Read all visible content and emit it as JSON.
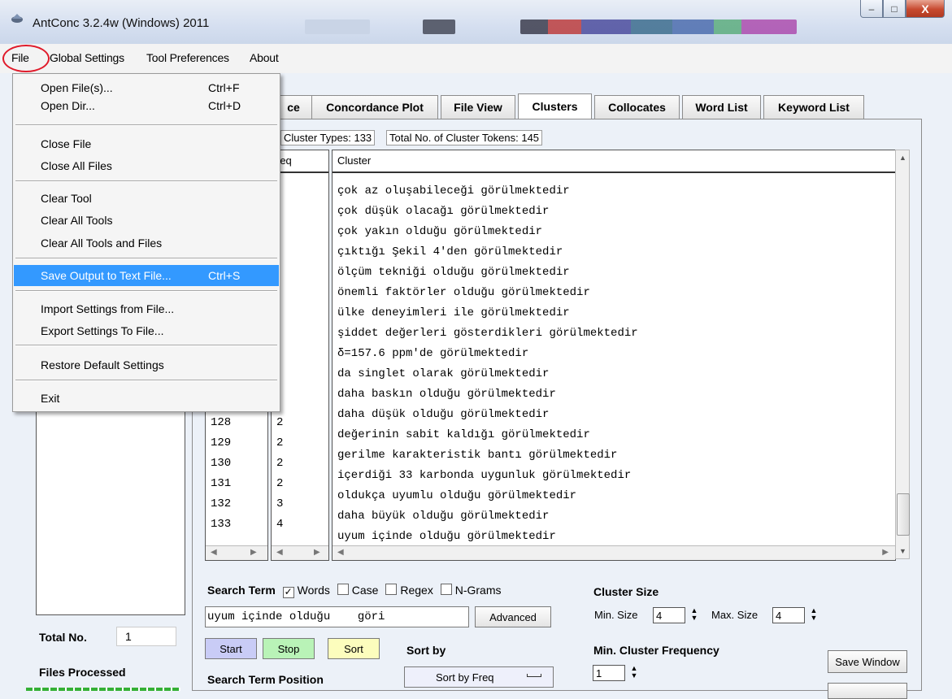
{
  "window": {
    "title": "AntConc 3.2.4w (Windows) 2011",
    "min": "–",
    "max": "□",
    "close": "X"
  },
  "menubar": {
    "file": "File",
    "global": "Global Settings",
    "tool": "Tool Preferences",
    "about": "About"
  },
  "file_menu": {
    "open_files": "Open File(s)...",
    "open_files_sc": "Ctrl+F",
    "open_dir": "Open Dir...",
    "open_dir_sc": "Ctrl+D",
    "close_file": "Close File",
    "close_all": "Close All Files",
    "clear_tool": "Clear Tool",
    "clear_all_tools": "Clear All Tools",
    "clear_all_tools_files": "Clear All Tools and Files",
    "save_output": "Save Output to Text File...",
    "save_output_sc": "Ctrl+S",
    "import_settings": "Import Settings from File...",
    "export_settings": "Export Settings To File...",
    "restore": "Restore Default Settings",
    "exit": "Exit"
  },
  "tabs": {
    "concordance": "ce",
    "plot": "Concordance Plot",
    "file_view": "File View",
    "clusters": "Clusters",
    "collocates": "Collocates",
    "word_list": "Word List",
    "keyword_list": "Keyword List"
  },
  "stats": {
    "types": "Cluster Types: 133",
    "tokens": "Total No. of Cluster Tokens: 145"
  },
  "columns": {
    "freq": "req",
    "cluster": "Cluster"
  },
  "clusters": [
    "çok az oluşabileceği görülmektedir",
    "çok düşük olacağı görülmektedir",
    "çok yakın olduğu görülmektedir",
    "çıktığı Şekil 4'den görülmektedir",
    "ölçüm tekniği olduğu görülmektedir",
    "önemli faktörler olduğu görülmektedir",
    "ülke deneyimleri ile görülmektedir",
    "şiddet değerleri gösterdikleri görülmektedir",
    "δ=157.6 ppm'de görülmektedir",
    "da singlet olarak görülmektedir",
    "daha baskın olduğu görülmektedir",
    "daha düşük olduğu görülmektedir",
    "değerinin sabit kaldığı görülmektedir",
    "gerilme karakteristik bantı görülmektedir",
    "içerdiği 33 karbonda uygunluk görülmektedir",
    "oldukça uyumlu olduğu görülmektedir",
    "daha büyük olduğu görülmektedir",
    "uyum içinde olduğu görülmektedir"
  ],
  "ranks": [
    "128",
    "129",
    "130",
    "131",
    "132",
    "133"
  ],
  "freqs": [
    "2",
    "2",
    "2",
    "2",
    "3",
    "4"
  ],
  "search": {
    "term_label": "Search Term",
    "words": "Words",
    "case": "Case",
    "regex": "Regex",
    "ngrams": "N-Grams",
    "value": "uyum içinde olduğu    göri",
    "advanced": "Advanced",
    "start": "Start",
    "stop": "Stop",
    "sort": "Sort",
    "sort_by": "Sort by",
    "sort_by_value": "Sort by Freq",
    "position": "Search Term Position"
  },
  "cluster_size": {
    "label": "Cluster Size",
    "min_label": "Min. Size",
    "min": "4",
    "max_label": "Max. Size",
    "max": "4",
    "freq_label": "Min. Cluster Frequency",
    "freq": "1"
  },
  "left": {
    "total_label": "Total No.",
    "total": "1",
    "processed": "Files Processed"
  },
  "save_window": "Save Window",
  "colors": {
    "highlight": "#3399ff",
    "circle": "#e01a2a"
  }
}
